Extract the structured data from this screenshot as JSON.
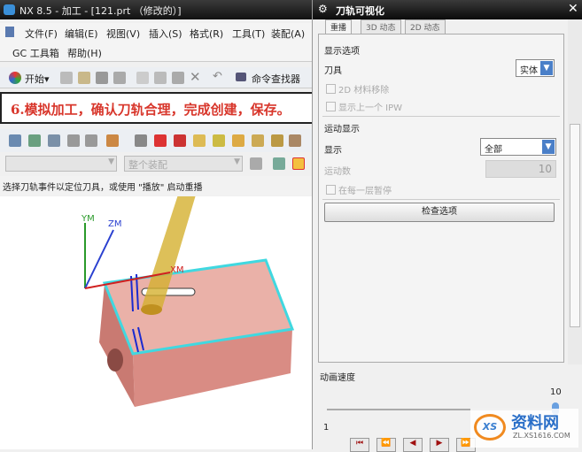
{
  "app": {
    "title": "NX 8.5 - 加工 - [121.prt （修改的）]"
  },
  "menu": {
    "items": [
      "文件(F)",
      "编辑(E)",
      "视图(V)",
      "插入(S)",
      "格式(R)",
      "工具(T)",
      "装配(A)",
      "GC 工具箱",
      "帮助(H)"
    ]
  },
  "toolbar": {
    "start": "开始▾",
    "command_finder": "命令查找器"
  },
  "banner": {
    "text": "6.模拟加工，确认刀轨合理，完成创建，保存。"
  },
  "filter": {
    "assembly_placeholder": "整个装配"
  },
  "status": {
    "text": "选择刀轨事件以定位刀具，或使用 \"播放\" 启动重播"
  },
  "viewport": {
    "axes": [
      "YM",
      "ZM",
      "XM"
    ]
  },
  "dialog": {
    "title": "刀轨可视化",
    "tabs": [
      "重播",
      "3D 动态",
      "2D 动态"
    ],
    "active_tab": "重播",
    "display_options": {
      "heading": "显示选项",
      "tool_label": "刀具",
      "tool_value": "实体",
      "material_removal_2d": "2D 材料移除",
      "show_prev_ipw": "显示上一个 IPW"
    },
    "motion_display": {
      "heading": "运动显示",
      "display_label": "显示",
      "display_value": "全部",
      "motions_label": "运动数",
      "motions_value": "10",
      "pause_each_layer": "在每一层暂停"
    },
    "check_options": "检查选项",
    "animation_speed": {
      "label": "动画速度",
      "min": "1",
      "max": "10",
      "value": 10
    }
  },
  "watermark": {
    "text": "资料网",
    "url": "ZL.XS1616.COM"
  },
  "colors": {
    "banner_text": "#d8362b",
    "part": "#e39a92",
    "edge": "#40d8e0",
    "tool": "#d8b830"
  }
}
